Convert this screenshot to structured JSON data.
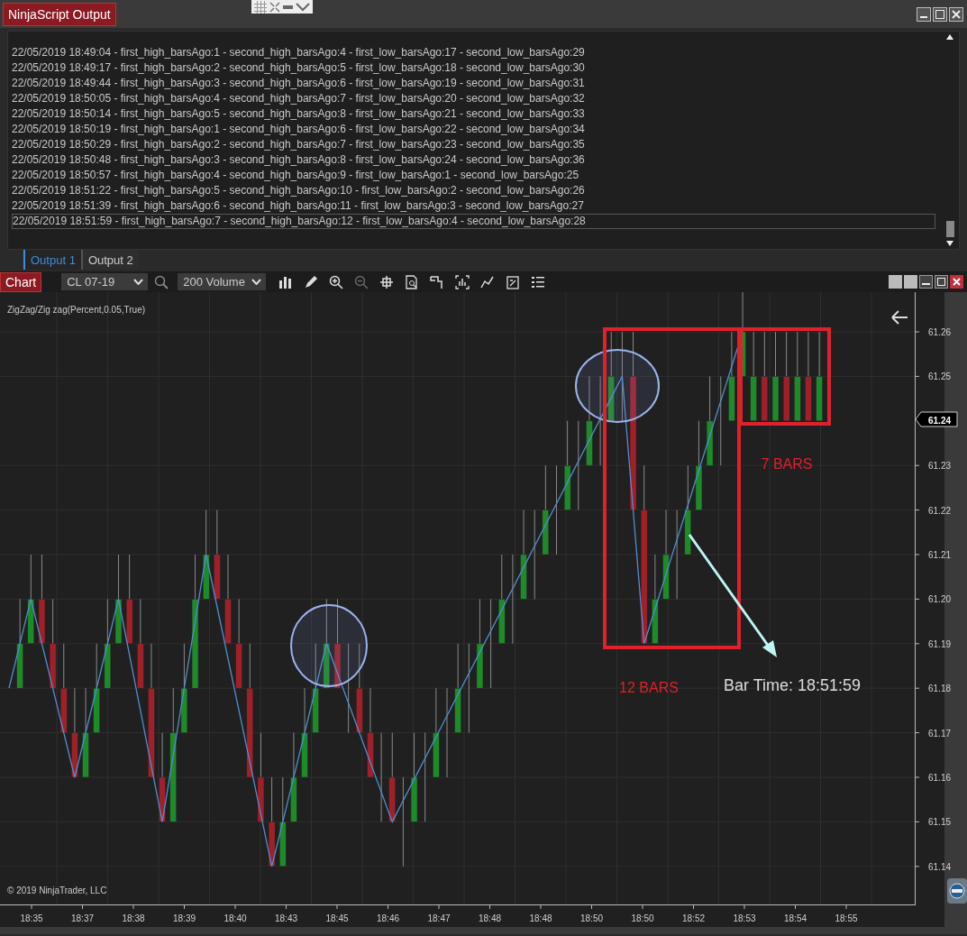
{
  "output_window": {
    "title": "NinjaScript Output",
    "lines": [
      {
        "text": "22/05/2019 18:49:04 - first_high_barsAgo:1 - second_high_barsAgo:4 - first_low_barsAgo:17 - second_low_barsAgo:29",
        "selected": false
      },
      {
        "text": "22/05/2019 18:49:17 - first_high_barsAgo:2 - second_high_barsAgo:5 - first_low_barsAgo:18 - second_low_barsAgo:30",
        "selected": false
      },
      {
        "text": "22/05/2019 18:49:44 - first_high_barsAgo:3 - second_high_barsAgo:6 - first_low_barsAgo:19 - second_low_barsAgo:31",
        "selected": false
      },
      {
        "text": "22/05/2019 18:50:05 - first_high_barsAgo:4 - second_high_barsAgo:7 - first_low_barsAgo:20 - second_low_barsAgo:32",
        "selected": false
      },
      {
        "text": "22/05/2019 18:50:14 - first_high_barsAgo:5 - second_high_barsAgo:8 - first_low_barsAgo:21 - second_low_barsAgo:33",
        "selected": false
      },
      {
        "text": "22/05/2019 18:50:19 - first_high_barsAgo:1 - second_high_barsAgo:6 - first_low_barsAgo:22 - second_low_barsAgo:34",
        "selected": false
      },
      {
        "text": "22/05/2019 18:50:29 - first_high_barsAgo:2 - second_high_barsAgo:7 - first_low_barsAgo:23 - second_low_barsAgo:35",
        "selected": false
      },
      {
        "text": "22/05/2019 18:50:48 - first_high_barsAgo:3 - second_high_barsAgo:8 - first_low_barsAgo:24 - second_low_barsAgo:36",
        "selected": false
      },
      {
        "text": "22/05/2019 18:50:57 - first_high_barsAgo:4 - second_high_barsAgo:9 - first_low_barsAgo:1 - second_low_barsAgo:25",
        "selected": false
      },
      {
        "text": "22/05/2019 18:51:22 - first_high_barsAgo:5 - second_high_barsAgo:10 - first_low_barsAgo:2 - second_low_barsAgo:26",
        "selected": false
      },
      {
        "text": "22/05/2019 18:51:39 - first_high_barsAgo:6 - second_high_barsAgo:11 - first_low_barsAgo:3 - second_low_barsAgo:27",
        "selected": false
      },
      {
        "text": "22/05/2019 18:51:59 - first_high_barsAgo:7 - second_high_barsAgo:12 - first_low_barsAgo:4 - second_low_barsAgo:28",
        "selected": true
      }
    ],
    "tabs": [
      {
        "label": "Output 1",
        "selected": true
      },
      {
        "label": "Output 2",
        "selected": false
      }
    ]
  },
  "chart_window": {
    "title": "Chart",
    "instrument": "CL 07-19",
    "bar_type": "200 Volume",
    "indicator_label": "ZigZag/Zig zag(Percent,0.05,True)",
    "price_axis": [
      "61.26",
      "61.25",
      "61.23",
      "61.22",
      "61.21",
      "61.20",
      "61.19",
      "61.18",
      "61.17",
      "61.16",
      "61.15",
      "61.14"
    ],
    "current_price": "61.24",
    "time_axis": [
      "18:35",
      "18:37",
      "18:38",
      "18:39",
      "18:40",
      "18:43",
      "18:45",
      "18:46",
      "18:47",
      "18:48",
      "18:48",
      "18:50",
      "18:50",
      "18:52",
      "18:53",
      "18:54",
      "18:55"
    ],
    "copyright": "© 2019 NinjaTrader, LLC",
    "annotations": [
      {
        "kind": "box_label",
        "text": "12 BARS"
      },
      {
        "kind": "box_label",
        "text": "7 BARS"
      },
      {
        "kind": "callout",
        "text": "Bar Time: 18:51:59"
      }
    ]
  }
}
